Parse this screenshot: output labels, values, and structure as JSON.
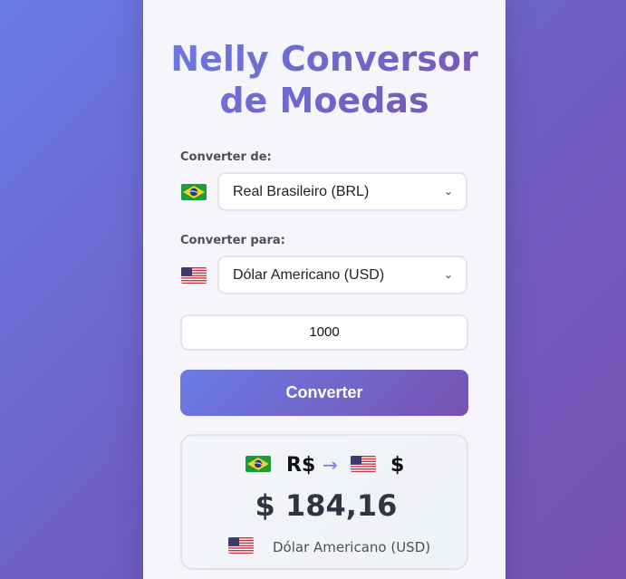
{
  "app": {
    "title": "Nelly Conversor de Moedas"
  },
  "from": {
    "label": "Converter de:",
    "flag": "brazil-flag-icon",
    "selected": "Real Brasileiro (BRL)"
  },
  "to": {
    "label": "Converter para:",
    "flag": "usa-flag-icon",
    "selected": "Dólar Americano (USD)"
  },
  "amount": {
    "value": "1000"
  },
  "convert_button": {
    "label": "Converter"
  },
  "result": {
    "from_symbol": "R$",
    "arrow": "→",
    "to_symbol": "$",
    "value": "$ 184,16",
    "currency_name": "Dólar Americano (USD)"
  },
  "colors": {
    "accent_start": "#6a7ce6",
    "accent_end": "#7752b0"
  }
}
